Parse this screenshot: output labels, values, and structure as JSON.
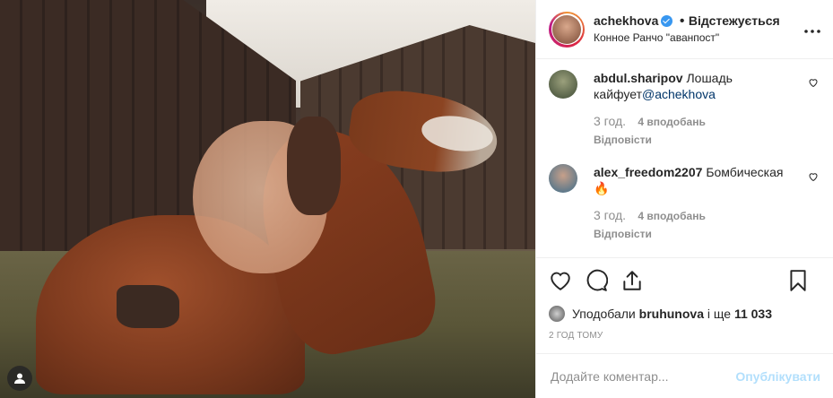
{
  "post": {
    "author": {
      "username": "achekhova",
      "verified": true,
      "follow_status": "Відстежується",
      "separator": "•",
      "location": "Конное Ранчо \"аванпост\""
    },
    "more_icon": "more-horizontal-icon",
    "comments": [
      {
        "username": "abdul.sharipov",
        "text": "Лошадь кайфует",
        "mention": "@achekhova",
        "time": "3 год.",
        "likes": "4 вподобань",
        "reply": "Відповісти"
      },
      {
        "username": "alex_freedom2207",
        "text": "Бомбическая",
        "emoji": "🔥",
        "time": "3 год.",
        "likes": "4 вподобань",
        "reply": "Відповісти"
      }
    ],
    "liked_by": {
      "prefix": "Уподобали",
      "user": "bruhunova",
      "suffix": "і ще",
      "count": "11 033"
    },
    "timestamp": "2 ГОД ТОМУ",
    "add_comment": {
      "placeholder": "Додайте коментар...",
      "submit": "Опублікувати"
    },
    "colors": {
      "verified": "#3897f0",
      "publish_disabled": "#b2dffc",
      "mention": "#003569",
      "secondary_text": "#8e8e8e"
    }
  }
}
